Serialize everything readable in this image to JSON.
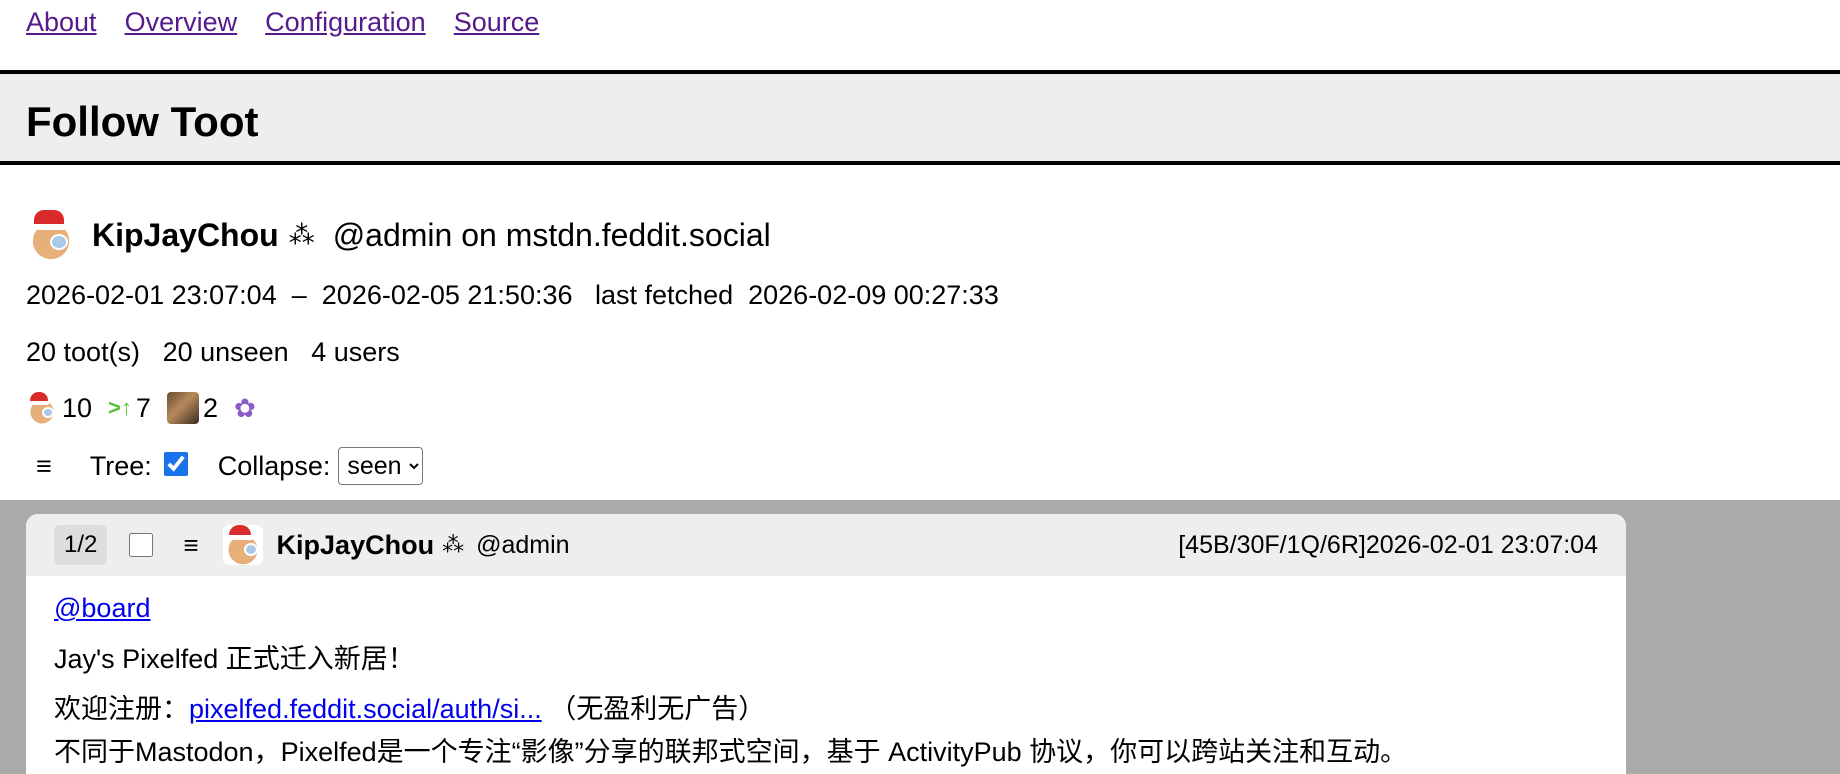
{
  "nav": {
    "about": "About",
    "overview": "Overview",
    "configuration": "Configuration",
    "source": "Source"
  },
  "page_title": "Follow Toot",
  "user": {
    "display_name": "KipJayChou",
    "decoration": "⁂",
    "handle_line": "@admin on mstdn.feddit.social"
  },
  "dates": {
    "start": "2026-02-01 23:07:04",
    "sep": "–",
    "end": "2026-02-05 21:50:36",
    "fetched_label": "last fetched",
    "fetched": "2026-02-09 00:27:33"
  },
  "counts": {
    "toots": "20 toot(s)",
    "unseen": "20 unseen",
    "users": "4 users"
  },
  "stats": {
    "user1_count": "10",
    "boost_glyph": ">↑",
    "boost_count": "7",
    "user3_count": "2"
  },
  "controls": {
    "menu_glyph": "≡",
    "tree_label": "Tree:",
    "tree_checked": true,
    "collapse_label": "Collapse:",
    "collapse_value": "seen"
  },
  "toot": {
    "pager": "1/2",
    "menu_glyph": "≡",
    "display_name": "KipJayChou",
    "decoration": "⁂",
    "handle": "@admin",
    "meta": "[45B/30F/1Q/6R]",
    "date": "2026-02-01 23:07:04",
    "mention": "@board",
    "line1": "Jay's Pixelfed 正式迁入新居！",
    "line2_prefix": "欢迎注册：",
    "line2_link": "pixelfed.feddit.social/auth/si...",
    "line2_suffix": "（无盈利无广告）",
    "line3": "不同于Mastodon，Pixelfed是一个专注“影像”分享的联邦式空间，基于 ActivityPub 协议，你可以跨站关注和互动。"
  },
  "colors": {
    "link_visited": "#551a8b",
    "link": "#0000ee",
    "title_bg": "#eeeeee",
    "gray_area": "#aaaaaa"
  }
}
